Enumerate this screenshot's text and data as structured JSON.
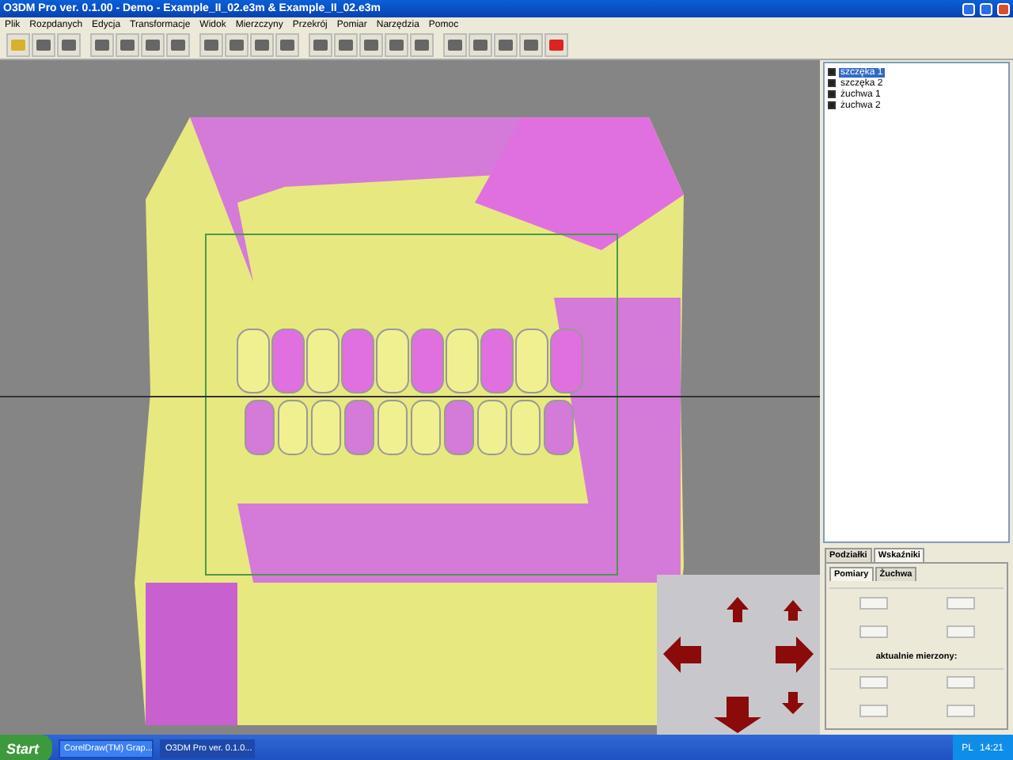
{
  "window": {
    "title": "O3DM Pro ver. 0.1.00 - Demo - Example_II_02.e3m & Example_II_02.e3m"
  },
  "menu": [
    "Plik",
    "Rozpdanych",
    "Edycja",
    "Transformacje",
    "Widok",
    "Mierzczyny",
    "Przekrój",
    "Pomiar",
    "Narzędzia",
    "Pomoc"
  ],
  "layers": [
    {
      "label": "szczęka 1",
      "checked": true,
      "selected": true
    },
    {
      "label": "szczęka 2",
      "checked": true,
      "selected": false
    },
    {
      "label": "żuchwa 1",
      "checked": true,
      "selected": false
    },
    {
      "label": "żuchwa 2",
      "checked": true,
      "selected": false
    }
  ],
  "tabs": [
    {
      "label": "Podziałki",
      "selected": false
    },
    {
      "label": "Wskaźniki",
      "selected": true
    }
  ],
  "subtabs": [
    {
      "label": "Pomiary",
      "selected": true
    },
    {
      "label": "Żuchwa",
      "selected": false
    }
  ],
  "measure_label": "aktualnie mierzony:",
  "taskbar": {
    "start": "Start",
    "tasks": [
      {
        "label": "CorelDraw(TM) Grap...",
        "selected": false
      },
      {
        "label": "O3DM Pro ver. 0.1.0...",
        "selected": true
      }
    ],
    "language": "PL",
    "clock": "14:21"
  }
}
